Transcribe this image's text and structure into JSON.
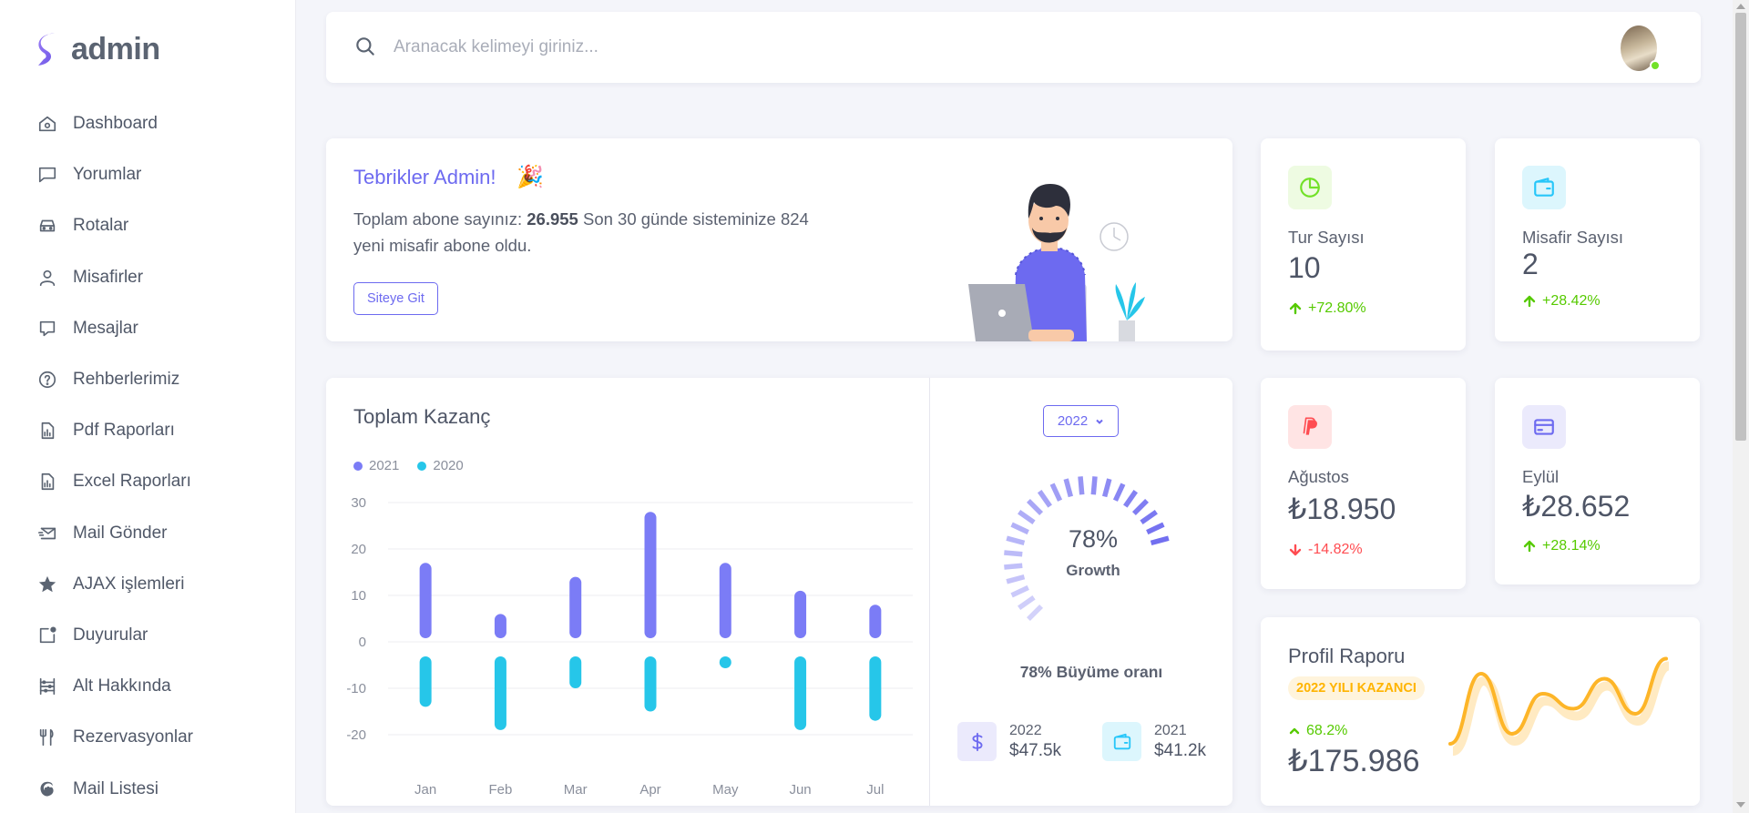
{
  "app": {
    "brand": "admin"
  },
  "sidebar": {
    "items": [
      {
        "label": "Dashboard",
        "icon": "home-icon"
      },
      {
        "label": "Yorumlar",
        "icon": "comment-icon"
      },
      {
        "label": "Rotalar",
        "icon": "car-icon"
      },
      {
        "label": "Misafirler",
        "icon": "user-icon"
      },
      {
        "label": "Mesajlar",
        "icon": "message-icon"
      },
      {
        "label": "Rehberlerimiz",
        "icon": "help-circle-icon"
      },
      {
        "label": "Pdf Raporları",
        "icon": "file-chart-icon"
      },
      {
        "label": "Excel Raporları",
        "icon": "file-chart-icon"
      },
      {
        "label": "Mail Gönder",
        "icon": "mail-send-icon"
      },
      {
        "label": "AJAX işlemleri",
        "icon": "star-icon"
      },
      {
        "label": "Duyurular",
        "icon": "notification-icon"
      },
      {
        "label": "Alt Hakkında",
        "icon": "abacus-icon"
      },
      {
        "label": "Rezervasyonlar",
        "icon": "cutlery-icon"
      },
      {
        "label": "Mail Listesi",
        "icon": "mailchimp-icon"
      }
    ]
  },
  "search": {
    "placeholder": "Aranacak kelimeyi giriniz..."
  },
  "congrats": {
    "title": "Tebrikler Admin!",
    "text_before": "Toplam abone sayınız: ",
    "subscriber_count": "26.955",
    "text_after": " Son 30 günde sisteminize 824 yeni misafir abone oldu.",
    "button": "Siteye Git"
  },
  "stats": {
    "tour": {
      "label": "Tur Sayısı",
      "value": "10",
      "change": "+72.80%",
      "color": "#72e128"
    },
    "guest": {
      "label": "Misafir Sayısı",
      "value": "2",
      "change": "+28.42%",
      "color": "#26c6f9"
    },
    "august": {
      "label": "Ağustos",
      "value": "₺18.950",
      "change": "-14.82%",
      "color": "#ff4c51"
    },
    "september": {
      "label": "Eylül",
      "value": "₺28.652",
      "change": "+28.14%",
      "color": "#6d6af0"
    }
  },
  "revenue": {
    "title": "Toplam Kazanç",
    "year_select": "2022",
    "growth_percent": "78%",
    "growth_label": "Growth",
    "growth_text": "78% Büyüme oranı",
    "mini": [
      {
        "year": "2022",
        "value": "$47.5k",
        "icon": "dollar-icon"
      },
      {
        "year": "2021",
        "value": "$41.2k",
        "icon": "wallet-icon"
      }
    ]
  },
  "chart_data": {
    "type": "bar",
    "categories": [
      "Jan",
      "Feb",
      "Mar",
      "Apr",
      "May",
      "Jun",
      "Jul"
    ],
    "series": [
      {
        "name": "2021",
        "color": "#7b7cf6",
        "values": [
          17,
          6,
          14,
          28,
          17,
          11,
          8
        ]
      },
      {
        "name": "2020",
        "color": "#26c6e9",
        "values": [
          -14,
          -19,
          -10,
          -15,
          -4,
          -19,
          -17
        ]
      }
    ],
    "ylim": [
      -20,
      30
    ],
    "yticks": [
      30,
      20,
      10,
      0,
      -10,
      -20
    ],
    "grid": true,
    "legend": "top-left"
  },
  "profile": {
    "title": "Profil Raporu",
    "badge": "2022 YILI KAZANCI",
    "change": "68.2%",
    "value": "₺175.986",
    "sparkline": [
      10,
      80,
      20,
      60,
      45,
      75,
      40,
      95
    ]
  }
}
